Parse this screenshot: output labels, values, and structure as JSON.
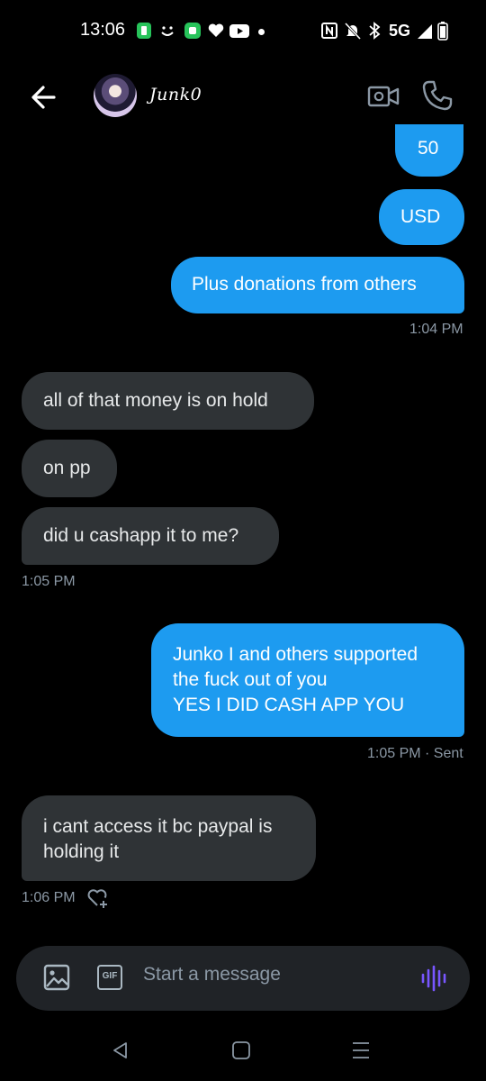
{
  "status_bar": {
    "time": "13:06",
    "network": "5G",
    "icons": [
      "messaging-icon",
      "smile-icon",
      "green-app-icon",
      "heart-icon",
      "youtube-icon",
      "nfc-icon",
      "mute-icon",
      "bluetooth-icon",
      "signal-icon",
      "battery-icon"
    ]
  },
  "header": {
    "contact_name": "Junk0",
    "icons": [
      "back-arrow-icon",
      "video-call-icon",
      "phone-icon"
    ]
  },
  "messages": [
    {
      "direction": "out",
      "text": "50"
    },
    {
      "direction": "out",
      "text": "USD"
    },
    {
      "direction": "out",
      "text": "Plus donations from others"
    },
    {
      "direction": "in",
      "text": "all of that money is on hold"
    },
    {
      "direction": "in",
      "text": "on pp"
    },
    {
      "direction": "in",
      "text": "did u cashapp it to me?"
    },
    {
      "direction": "out",
      "lines": [
        "Junko I and others supported",
        "the fuck out of you",
        "YES I DID CASH APP YOU"
      ]
    },
    {
      "direction": "in",
      "lines": [
        "i cant access it bc paypal is",
        "holding it"
      ]
    }
  ],
  "timestamps": {
    "t1": "1:04 PM",
    "t2": "1:05 PM",
    "t3": "1:05 PM · Sent",
    "t4": "1:06 PM"
  },
  "composer": {
    "placeholder": "Start a message",
    "gif_label": "GIF",
    "icons": [
      "image-icon",
      "gif-icon",
      "voice-icon"
    ]
  },
  "colors": {
    "background": "#000000",
    "outgoing_bubble": "#1d9bf0",
    "incoming_bubble": "#2f3336",
    "voice_accent": "#7856ff"
  }
}
